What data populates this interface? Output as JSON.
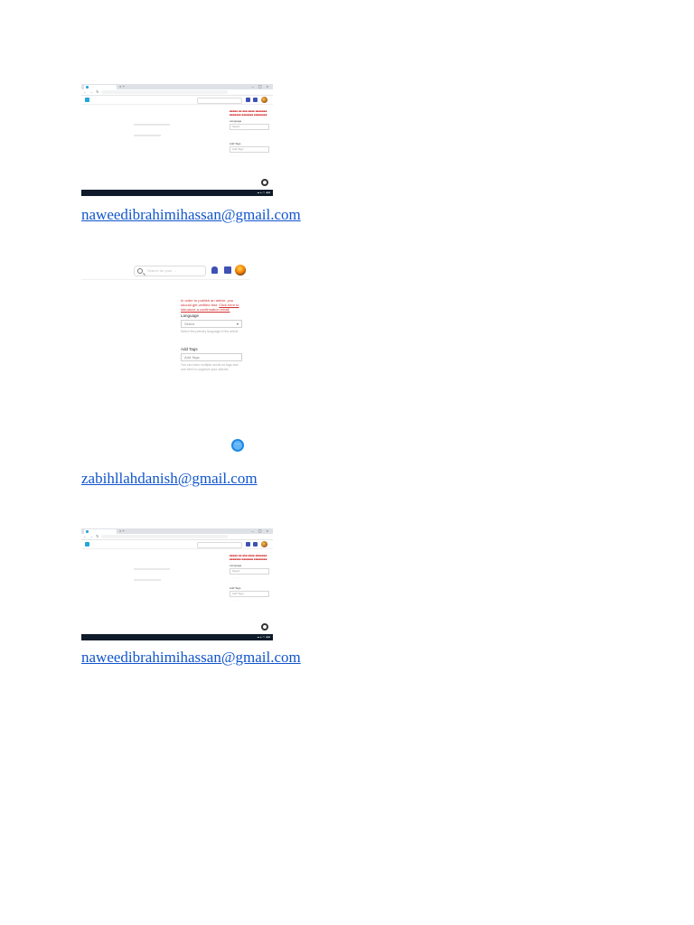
{
  "emails": [
    {
      "text": "naweedibrahimihassan@gmail.com"
    },
    {
      "text": "zabihllahdanish@gmail.com"
    },
    {
      "text": "naweedibrahimihassan@gmail.com"
    }
  ],
  "screenshots": {
    "zoomed": {
      "search_placeholder": "Search for your ...",
      "warning_text": "In order to publish an article, you should get verified first.",
      "warning_link": "Click here to introduce a confirmation email.",
      "language_label": "Language",
      "language_value": "Select",
      "language_hint": "Select the primary language of the article",
      "tags_label": "Add Tags",
      "tags_placeholder": "Add Tags",
      "tags_hint": "You can have multiple words as tags and use them to organize your articles."
    },
    "small": {
      "language_label": "Language",
      "language_value": "Select",
      "tags_label": "Add Tags",
      "tags_placeholder": "Add Tags"
    }
  },
  "colors": {
    "link": "#1155cc",
    "warning": "#d32f2f",
    "accent": "#3f51b5",
    "taskbar": "#0f1a2a"
  }
}
